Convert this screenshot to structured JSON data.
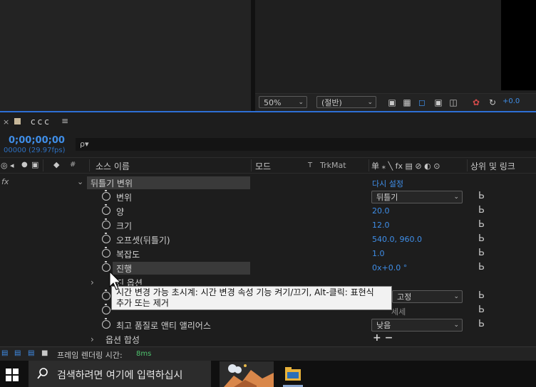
{
  "viewer": {
    "zoom": "50%",
    "resolution": "(절반)",
    "exposure": "+0.0"
  },
  "timeline": {
    "close": "×",
    "comp_name": "ccc",
    "menu": "≡",
    "timecode": "0;00;00;00",
    "fps": "00000 (29.97fps)",
    "search_icon": "ρ▾"
  },
  "columns": {
    "source_name": "소스 이름",
    "mode": "모드",
    "t": "T",
    "trkmat": "TrkMat",
    "switches": "单 ⁎ ╲ fx ▤ ⊘ ◐ ⊙",
    "parent_link": "상위 및 링크",
    "hash": "#"
  },
  "effect": {
    "fx": "fx",
    "name": "뒤틀기 변위",
    "reset": "다시 설정"
  },
  "props": [
    {
      "label": "변위",
      "value": "뒤틀기",
      "type": "dropdown"
    },
    {
      "label": "양",
      "value": "20.0",
      "type": "value"
    },
    {
      "label": "크기",
      "value": "12.0",
      "type": "value"
    },
    {
      "label": "오프셋(뒤틀기)",
      "value": "540.0, 960.0",
      "type": "value"
    },
    {
      "label": "복잡도",
      "value": "1.0",
      "type": "value"
    },
    {
      "label": "진행",
      "value": "0x+0.0 °",
      "type": "value"
    }
  ],
  "more_rows": {
    "options_group": "진   옵션",
    "row_hidden_value": "고정",
    "row_hidden_value2": "세세",
    "antialias_label": "최고 품질로 앤티 앨리어스",
    "antialias_value": "낮음",
    "compositing": "옵션 합성",
    "plus_minus": "+ −"
  },
  "tooltip": {
    "line1": "시간 변경 가능 초시계: 시간 변경 속성 기능 켜기/끄기, Alt-클릭: 표현식",
    "line2": "추가 또는 제거"
  },
  "footer": {
    "render_label": "프레임 렌더링 시간:",
    "render_value": "8ms"
  },
  "taskbar": {
    "search_placeholder": "검색하려면 여기에 입력하십시",
    "windows_icon": "windows-logo",
    "explorer_icon": "folder-icon"
  },
  "colors": {
    "accent_blue": "#3f8ee8",
    "panel_border": "#2d6fd6",
    "tooltip_bg": "#f2f2f2"
  }
}
